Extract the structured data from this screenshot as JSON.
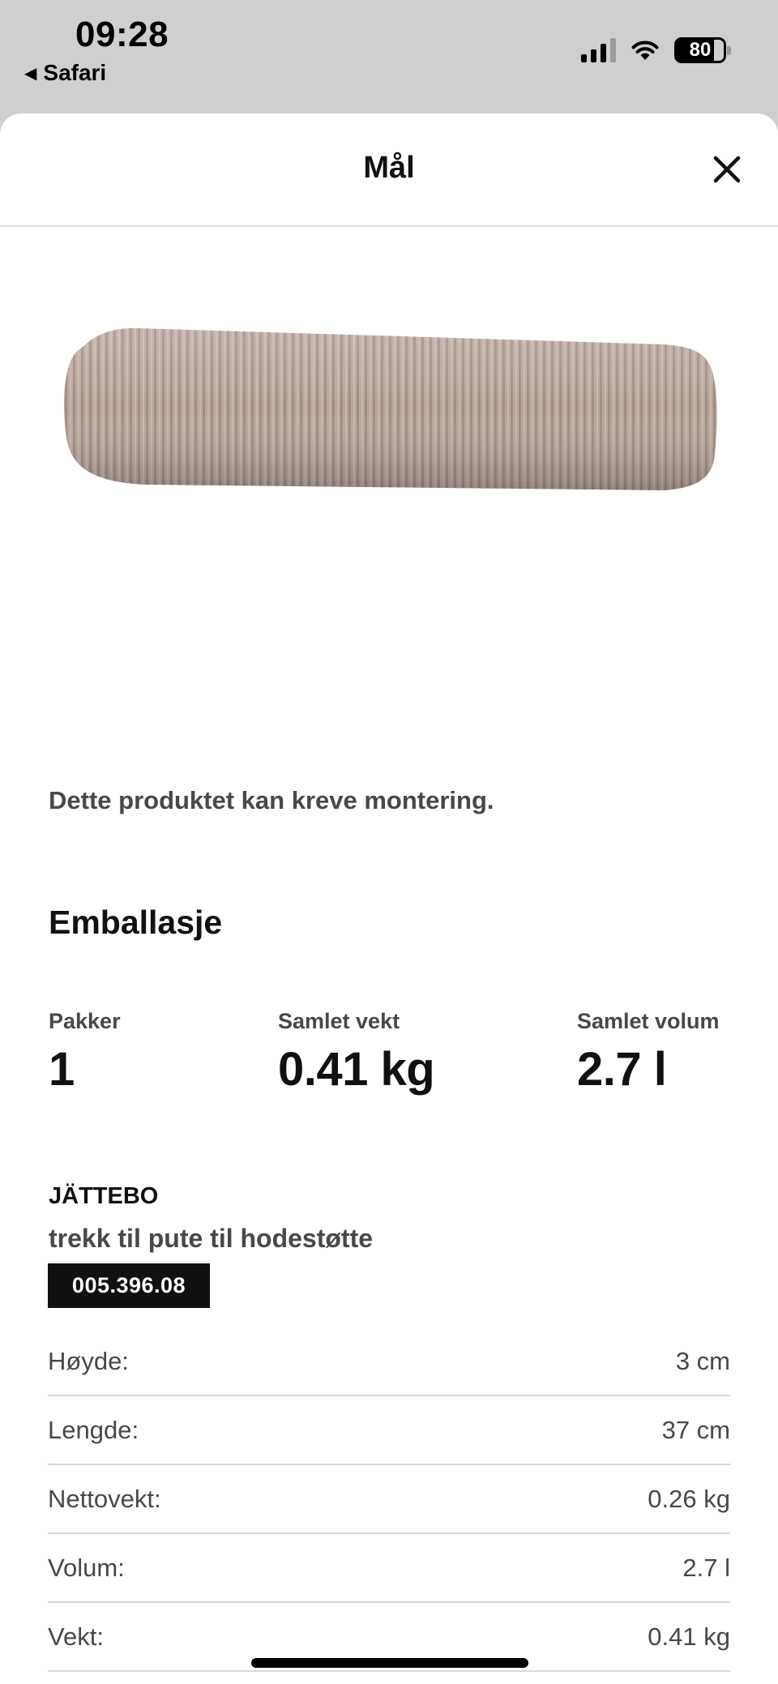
{
  "status_bar": {
    "time": "09:28",
    "back_app": "Safari",
    "battery": "80"
  },
  "sheet": {
    "title": "Mål",
    "close_icon": "close-icon"
  },
  "product_image": {
    "description_icon": "product-image",
    "color": "#b29f95"
  },
  "assembly_note": "Dette produktet kan kreve montering.",
  "packaging": {
    "heading": "Emballasje",
    "stats": [
      {
        "label": "Pakker",
        "value": "1"
      },
      {
        "label": "Samlet vekt",
        "value": "0.41 kg"
      },
      {
        "label": "Samlet volum",
        "value": "2.7 l"
      }
    ]
  },
  "product": {
    "name": "JÄTTEBO",
    "description": "trekk til pute til hodestøtte",
    "article_number": "005.396.08"
  },
  "specs": [
    {
      "label": "Høyde:",
      "value": "3 cm"
    },
    {
      "label": "Lengde:",
      "value": "37 cm"
    },
    {
      "label": "Nettovekt:",
      "value": "0.26 kg"
    },
    {
      "label": "Volum:",
      "value": "2.7 l"
    },
    {
      "label": "Vekt:",
      "value": "0.41 kg"
    }
  ]
}
